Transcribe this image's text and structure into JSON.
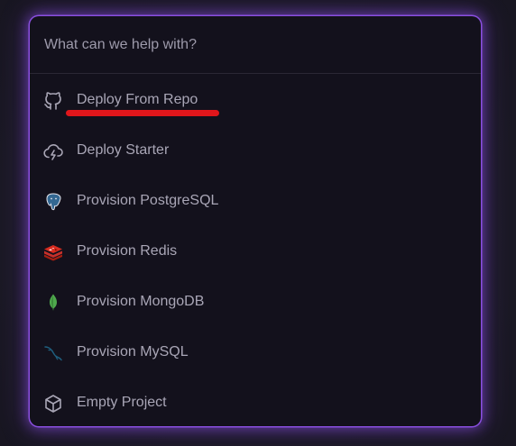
{
  "search": {
    "placeholder": "What can we help with?"
  },
  "items": [
    {
      "label": "Deploy From Repo",
      "icon": "github-icon"
    },
    {
      "label": "Deploy Starter",
      "icon": "cloud-lightning-icon"
    },
    {
      "label": "Provision PostgreSQL",
      "icon": "postgresql-icon"
    },
    {
      "label": "Provision Redis",
      "icon": "redis-icon"
    },
    {
      "label": "Provision MongoDB",
      "icon": "mongodb-icon"
    },
    {
      "label": "Provision MySQL",
      "icon": "mysql-icon"
    },
    {
      "label": "Empty Project",
      "icon": "cube-icon"
    }
  ],
  "colors": {
    "panel_background": "#13111c",
    "panel_glow": "#8a4fe0",
    "text": "#a9a6b6",
    "annotation": "#e0161b"
  }
}
